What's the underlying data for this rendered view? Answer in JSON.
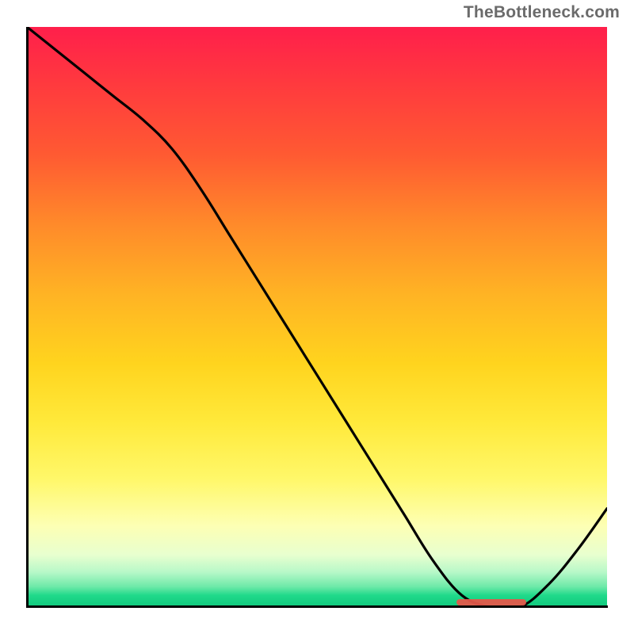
{
  "watermark": "TheBottleneck.com",
  "chart_data": {
    "type": "line",
    "title": "",
    "xlabel": "",
    "ylabel": "",
    "xlim": [
      0,
      100
    ],
    "ylim": [
      0,
      100
    ],
    "series": [
      {
        "name": "curve",
        "x": [
          0,
          5,
          10,
          15,
          20,
          25,
          30,
          35,
          40,
          45,
          50,
          55,
          60,
          65,
          70,
          75,
          80,
          85,
          90,
          95,
          100
        ],
        "y": [
          100,
          96,
          92,
          88,
          84,
          79,
          72,
          64,
          56,
          48,
          40,
          32,
          24,
          16,
          8,
          2,
          0,
          0,
          4,
          10,
          17
        ]
      }
    ],
    "optimal_marker": {
      "x_start": 74,
      "x_end": 86,
      "y": 0.8
    },
    "gradient_stops": [
      {
        "pos": 0,
        "color": "#ff1f4b"
      },
      {
        "pos": 0.5,
        "color": "#ffd41e"
      },
      {
        "pos": 0.86,
        "color": "#fdffb4"
      },
      {
        "pos": 1.0,
        "color": "#10c97d"
      }
    ]
  }
}
